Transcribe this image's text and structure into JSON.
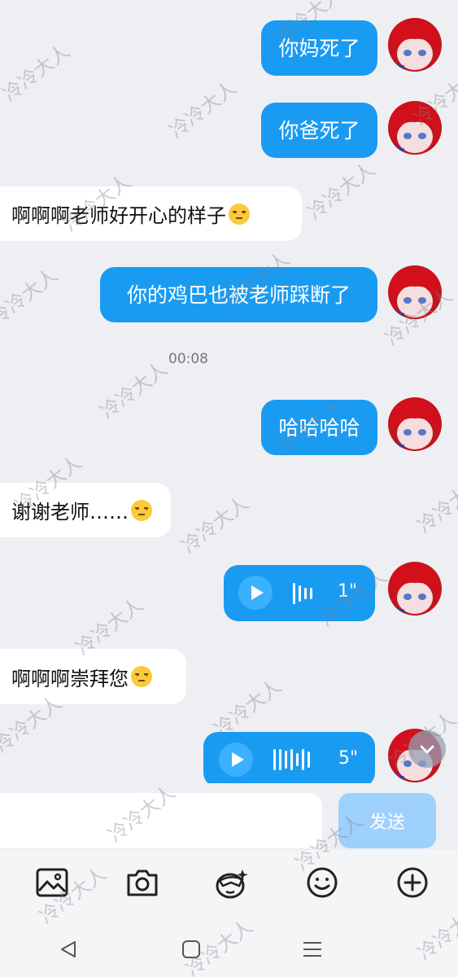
{
  "messages": [
    {
      "dir": "out",
      "type": "text",
      "text": "你妈死了"
    },
    {
      "dir": "out",
      "type": "text",
      "text": "你爸死了"
    },
    {
      "dir": "in",
      "type": "text",
      "text": "啊啊啊老师好开心的样子",
      "emoji": "unamused-face"
    },
    {
      "dir": "out",
      "type": "text",
      "text": "你的鸡巴也被老师踩断了"
    },
    {
      "dir": "out",
      "type": "text",
      "text": "哈哈哈哈"
    },
    {
      "dir": "in",
      "type": "text",
      "text": "谢谢老师……",
      "emoji": "unamused-face"
    },
    {
      "dir": "out",
      "type": "voice",
      "duration": "1\""
    },
    {
      "dir": "in",
      "type": "text",
      "text": "啊啊啊崇拜您",
      "emoji": "unamused-face"
    },
    {
      "dir": "out",
      "type": "voice",
      "duration": "5\""
    }
  ],
  "timestamp": "00:08",
  "input": {
    "value": "",
    "send_label": "发送"
  },
  "toolbar": [
    "image-icon",
    "camera-icon",
    "sticker-icon",
    "emoji-icon",
    "plus-icon"
  ],
  "navbar": [
    "back-icon",
    "home-icon",
    "menu-icon"
  ],
  "watermark": "冷冷大人",
  "colors": {
    "outgoing_bubble": "#1a9bf2",
    "incoming_bubble": "#ffffff",
    "background": "#eeeff3",
    "send_disabled": "#9dd1fb"
  }
}
